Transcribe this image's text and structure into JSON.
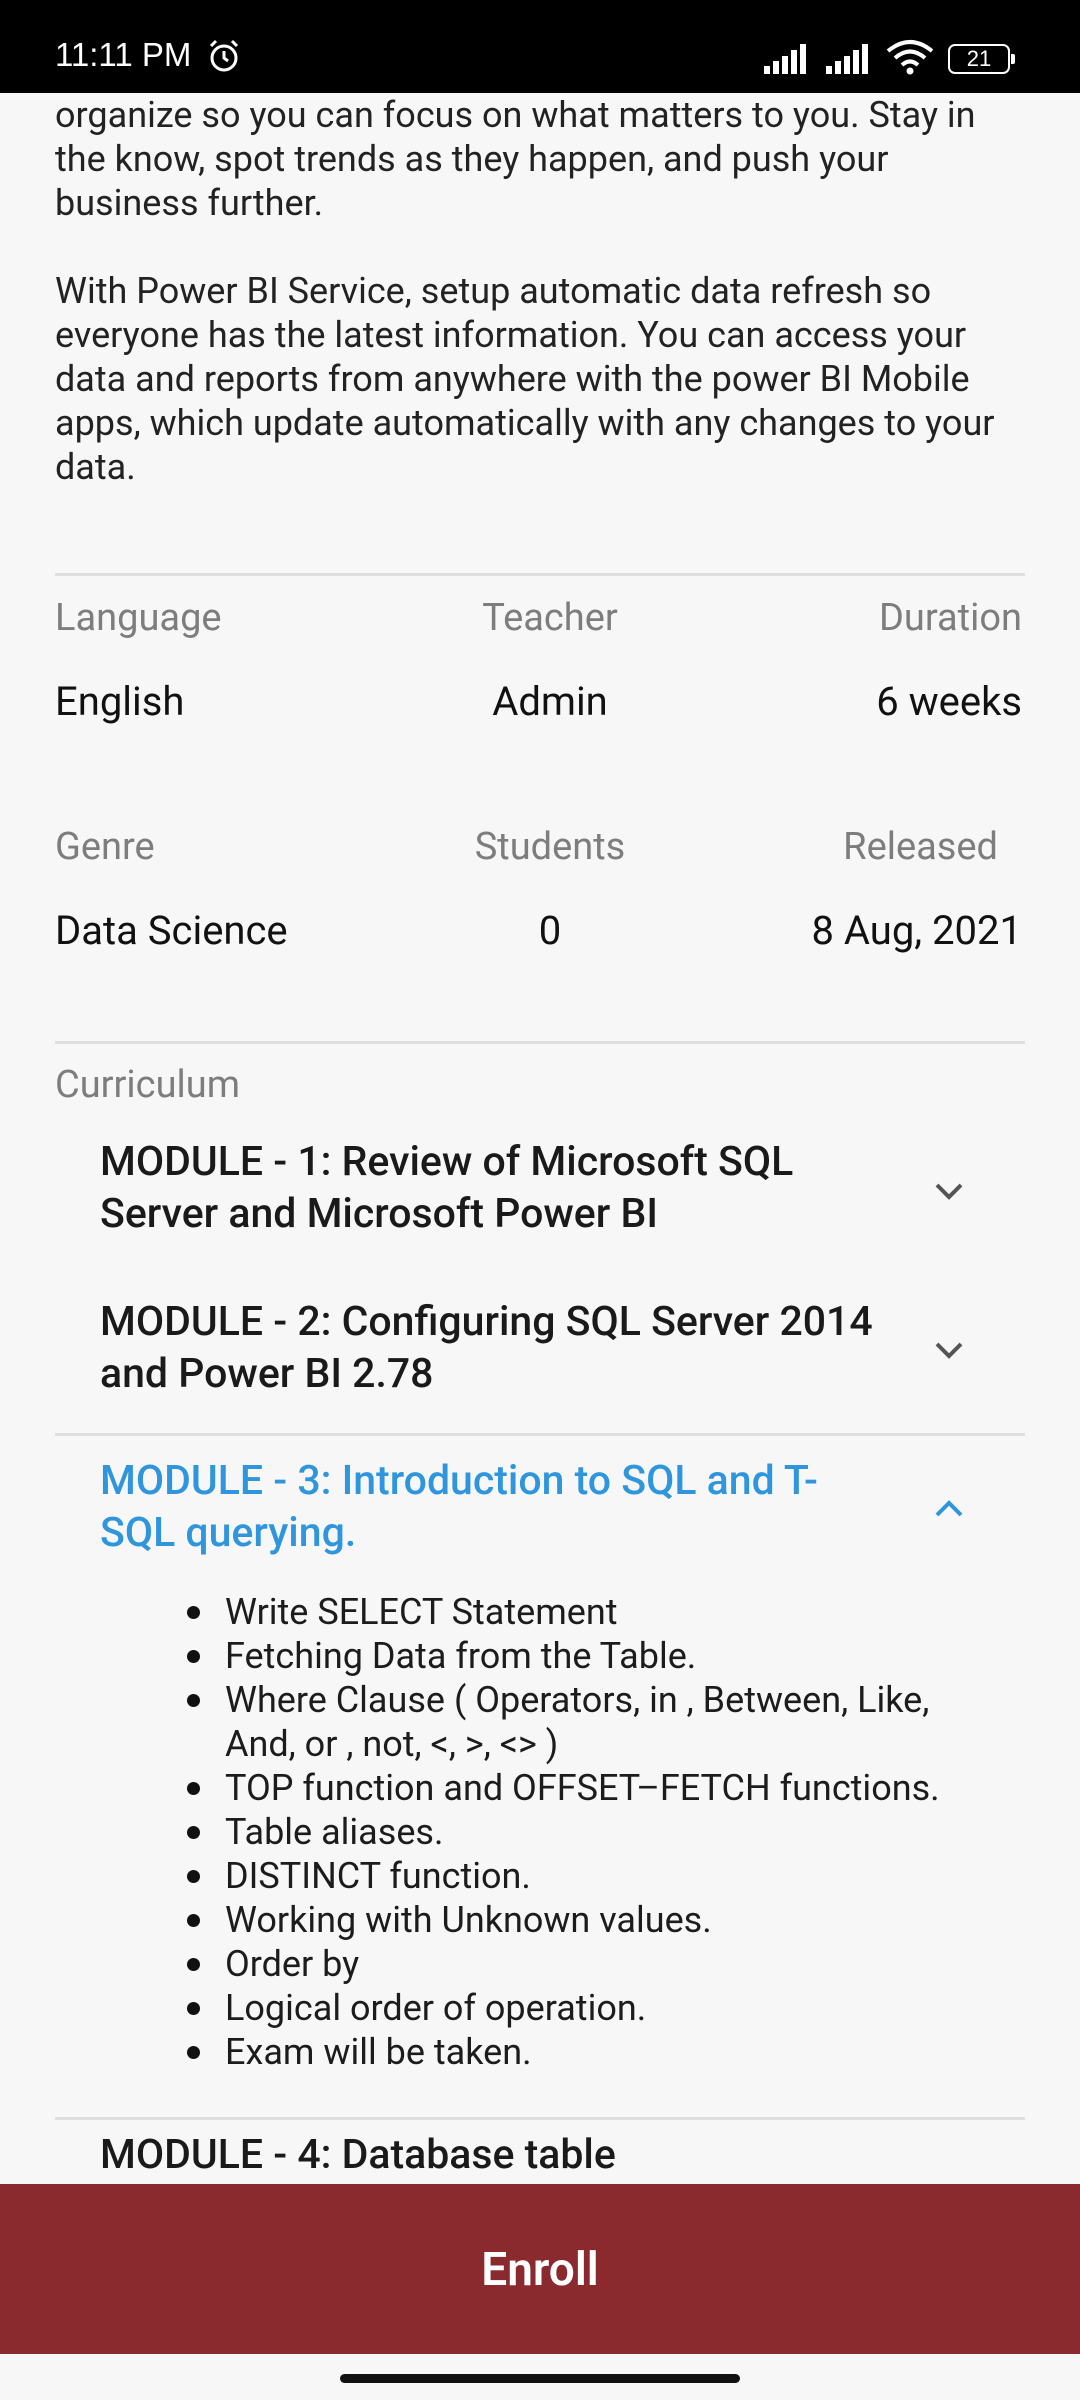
{
  "status_bar": {
    "time": "11:11 PM",
    "battery": "21"
  },
  "description": {
    "para1": "organize so you can focus on what matters to you. Stay in the know, spot trends as they happen, and push your business further.",
    "para2": "With Power BI Service, setup automatic data refresh so everyone has the latest information. You can access your data and reports from anywhere with the power BI Mobile apps, which update automatically with any changes to your data."
  },
  "info": {
    "language_label": "Language",
    "language_value": "English",
    "teacher_label": "Teacher",
    "teacher_value": "Admin",
    "duration_label": "Duration",
    "duration_value": "6 weeks",
    "genre_label": "Genre",
    "genre_value": "Data Science",
    "students_label": "Students",
    "students_value": "0",
    "released_label": "Released",
    "released_value": "8 Aug, 2021"
  },
  "curriculum": {
    "label": "Curriculum",
    "modules": [
      {
        "title": "MODULE - 1: Review of Microsoft SQL Server and Microsoft Power BI",
        "expanded": false
      },
      {
        "title": "MODULE - 2: Configuring SQL Server 2014 and Power BI 2.78",
        "expanded": false
      },
      {
        "title": "MODULE - 3: Introduction to SQL and T-SQL querying.",
        "expanded": true,
        "items": [
          "Write SELECT Statement",
          "Fetching Data from the Table.",
          "Where Clause ( Operators, in , Between, Like, And, or , not, <, >, <> )",
          "TOP function and OFFSET–FETCH functions.",
          "Table aliases.",
          "DISTINCT function.",
          "Working with Unknown values.",
          "Order by",
          "Logical order of operation.",
          "Exam will be taken."
        ]
      },
      {
        "title": "MODULE - 4: Database table",
        "expanded": false
      }
    ]
  },
  "actions": {
    "enroll_label": "Enroll"
  },
  "colors": {
    "accent": "#2f96de",
    "enroll_bg": "#8b2a2e"
  }
}
